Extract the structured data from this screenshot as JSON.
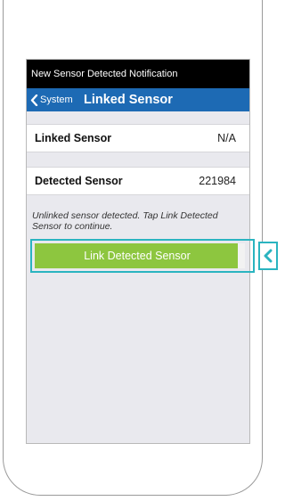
{
  "notification": {
    "title": "New Sensor Detected Notification"
  },
  "nav": {
    "back_label": "System",
    "title": "Linked Sensor"
  },
  "rows": [
    {
      "label": "Linked Sensor",
      "value": "N/A"
    },
    {
      "label": "Detected Sensor",
      "value": "221984"
    }
  ],
  "hint": "Unlinked sensor detected. Tap Link Detected Sensor to continue.",
  "button": {
    "label": "Link Detected Sensor"
  },
  "colors": {
    "notification_bar": "#000000",
    "nav_bar": "#1d6ab4",
    "button": "#8dc63f",
    "highlight": "#2ab4c0",
    "screen_bg": "#e9e9ee"
  },
  "icons": {
    "back": "chevron-left-icon",
    "pointer": "chevron-left-icon"
  }
}
